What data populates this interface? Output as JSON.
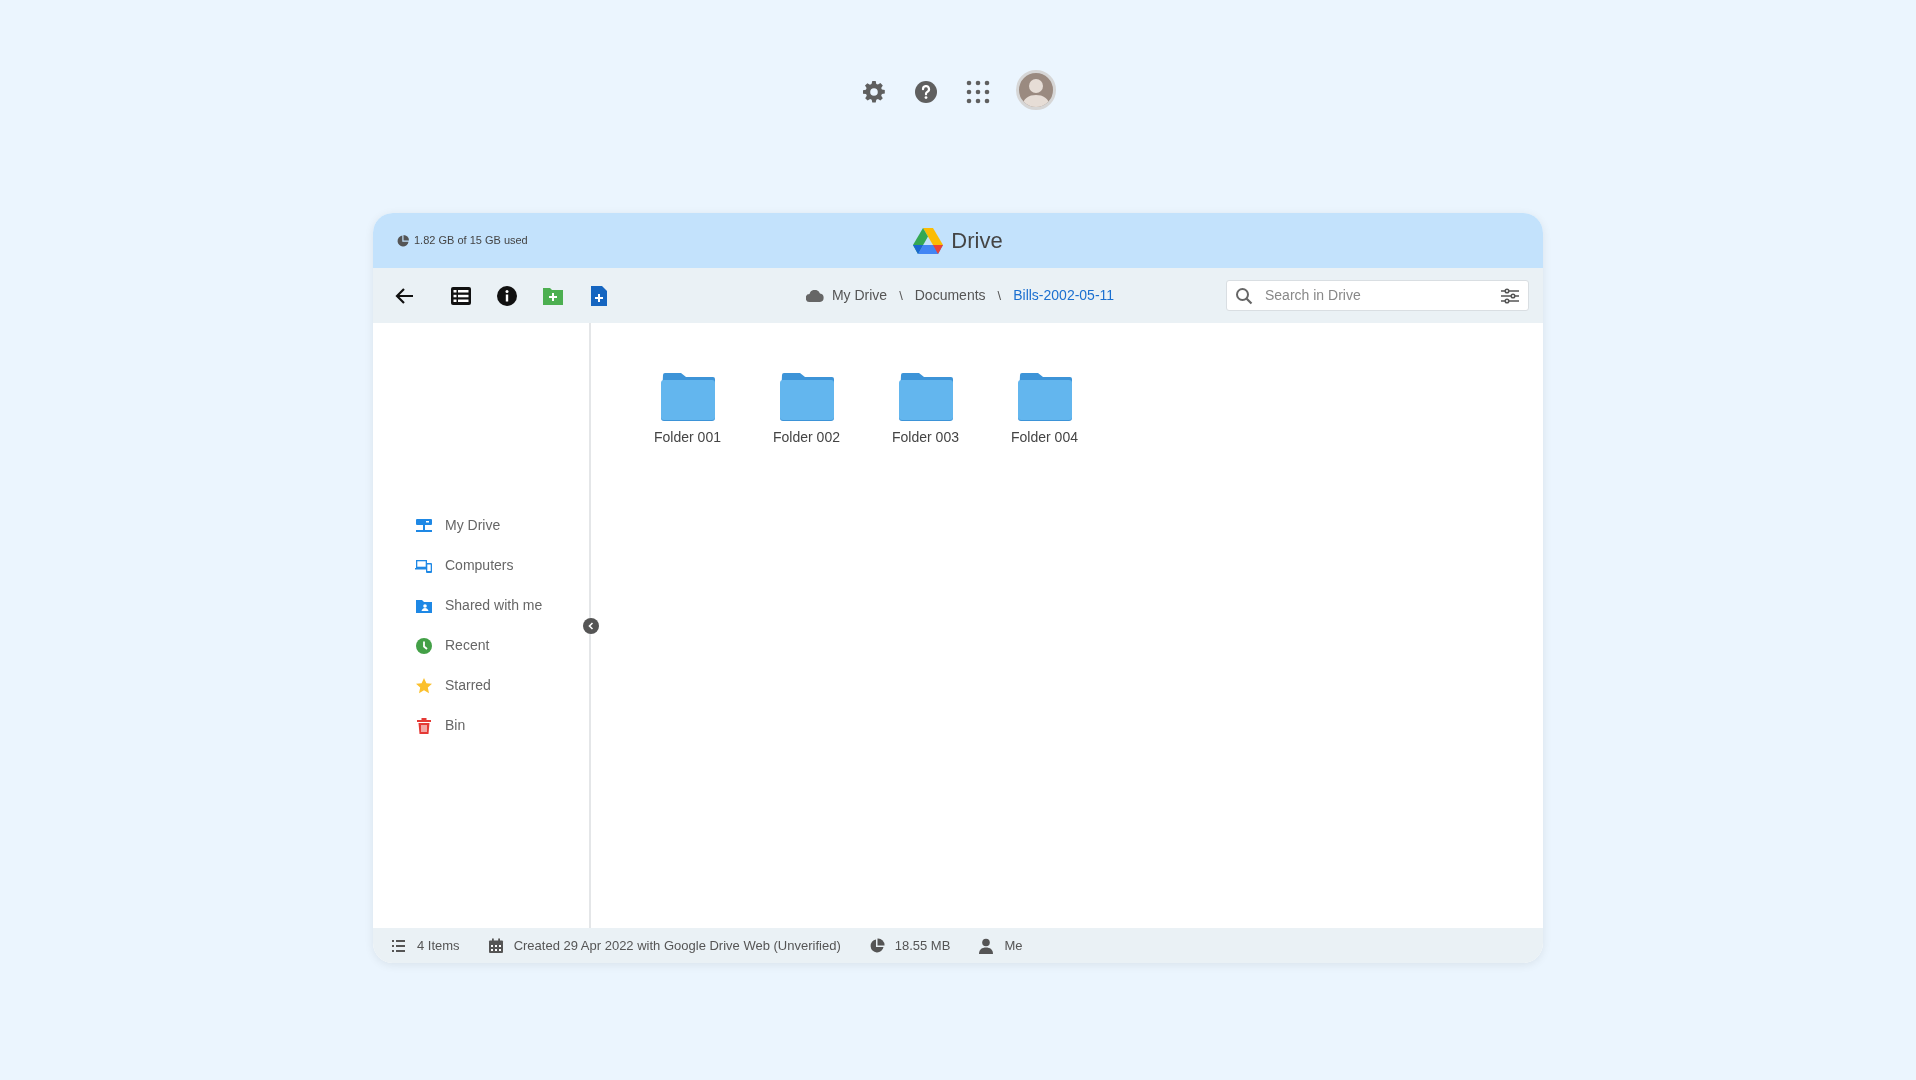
{
  "window": {
    "storage": "1.82 GB of 15 GB used",
    "title": "Drive"
  },
  "breadcrumb": [
    {
      "label": "My Drive",
      "selected": false
    },
    {
      "label": "Documents",
      "selected": false
    },
    {
      "label": "Bills-2002-05-11",
      "selected": true
    }
  ],
  "breadcrumb_separator": "\\",
  "search": {
    "placeholder": "Search in Drive"
  },
  "sidebar": {
    "items": [
      {
        "label": "My Drive"
      },
      {
        "label": "Computers"
      },
      {
        "label": "Shared with me"
      },
      {
        "label": "Recent"
      },
      {
        "label": "Starred"
      },
      {
        "label": "Bin"
      }
    ]
  },
  "folders": [
    {
      "name": "Folder 001"
    },
    {
      "name": "Folder 002"
    },
    {
      "name": "Folder 003"
    },
    {
      "name": "Folder 004"
    }
  ],
  "status_bar": [
    {
      "text": "4 Items"
    },
    {
      "text": "Created 29 Apr 2022 with Google Drive Web (Unverified)"
    },
    {
      "text": "18.55 MB"
    },
    {
      "text": "Me"
    }
  ]
}
